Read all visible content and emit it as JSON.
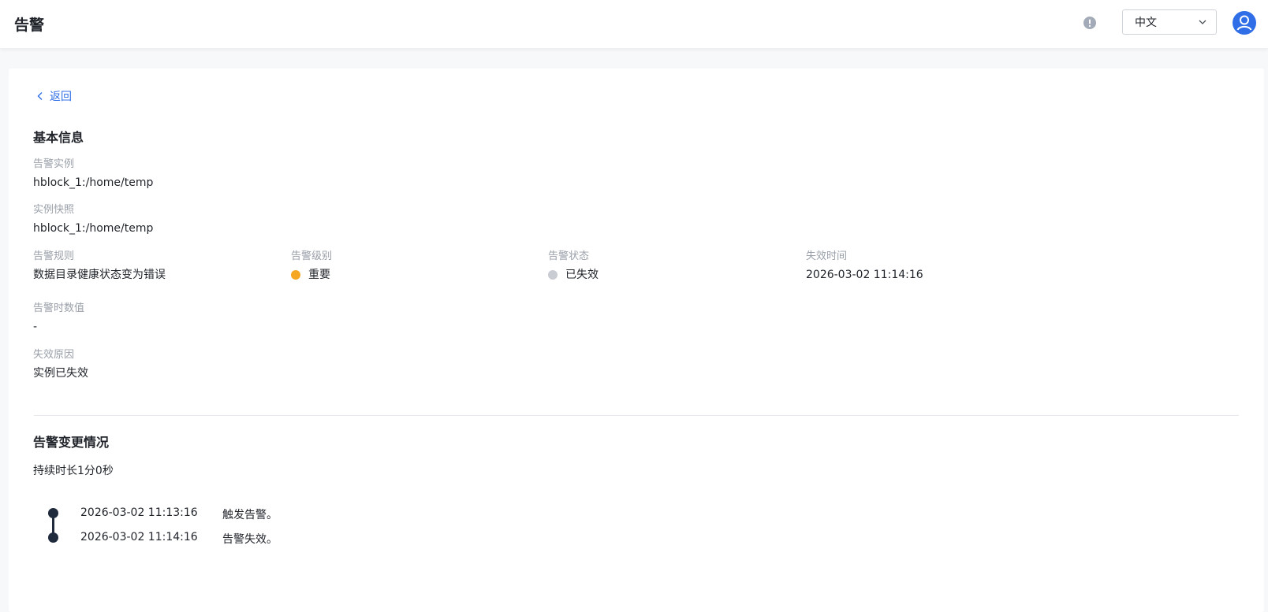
{
  "header": {
    "title": "告警",
    "language": "中文"
  },
  "back": {
    "label": "返回"
  },
  "basic_info": {
    "title": "基本信息",
    "instance": {
      "label": "告警实例",
      "value": "hblock_1:/home/temp"
    },
    "snapshot": {
      "label": "实例快照",
      "value": "hblock_1:/home/temp"
    },
    "rule": {
      "label": "告警规则",
      "value": "数据目录健康状态变为错误"
    },
    "level": {
      "label": "告警级别",
      "value": "重要",
      "color": "#f5a623"
    },
    "status": {
      "label": "告警状态",
      "value": "已失效",
      "color": "#c9ccd2"
    },
    "expire_time": {
      "label": "失效时间",
      "value": "2026-03-02 11:14:16"
    },
    "alarm_value": {
      "label": "告警时数值",
      "value": "-"
    },
    "expire_reason": {
      "label": "失效原因",
      "value": "实例已失效"
    }
  },
  "changes": {
    "title": "告警变更情况",
    "duration": "持续时长1分0秒",
    "events": [
      {
        "time": "2026-03-02 11:13:16",
        "text": "触发告警。"
      },
      {
        "time": "2026-03-02 11:14:16",
        "text": "告警失效。"
      }
    ]
  },
  "colors": {
    "accent": "#2f6ee6",
    "timeline": "#1f2a3d"
  }
}
